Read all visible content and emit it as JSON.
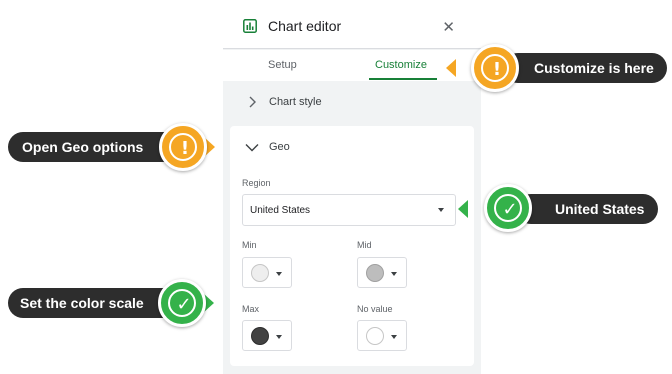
{
  "editor": {
    "title": "Chart editor",
    "close_icon": "✕",
    "tabs": [
      {
        "label": "Setup",
        "selected": false
      },
      {
        "label": "Customize",
        "selected": true
      }
    ],
    "sections": {
      "chart_style": "Chart style",
      "geo": "Geo"
    },
    "geo": {
      "region_label": "Region",
      "region_value": "United States",
      "min_label": "Min",
      "mid_label": "Mid",
      "max_label": "Max",
      "no_value_label": "No value",
      "colors": {
        "min": "#eeeeee",
        "mid": "#bdbdbd",
        "max": "#424242",
        "no_value": "#ffffff"
      }
    }
  },
  "callouts": {
    "customize": "Customize is here",
    "geo": "Open Geo options",
    "united_states": "United States",
    "color_scale": "Set the color scale"
  },
  "colors": {
    "accent_green": "#188038",
    "badge_orange": "#f5a623",
    "badge_green": "#34b24a",
    "callout_bg": "#2d2d2d"
  }
}
